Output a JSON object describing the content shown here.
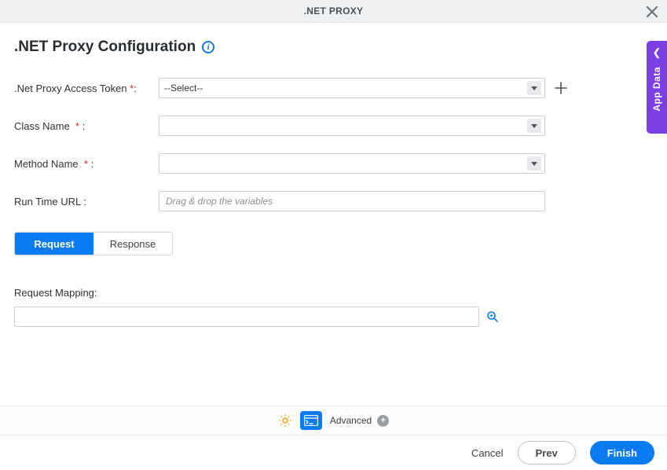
{
  "titlebar": {
    "title": ".NET PROXY"
  },
  "header": {
    "title": ".NET Proxy Configuration"
  },
  "form": {
    "access_token": {
      "label": ".Net Proxy Access Token",
      "required": "*",
      "colon": ":",
      "value": "--Select--"
    },
    "class_name": {
      "label": "Class Name",
      "required": "*",
      "colon": ":",
      "value": ""
    },
    "method_name": {
      "label": "Method Name",
      "required": "*",
      "colon": ":",
      "value": ""
    },
    "runtime_url": {
      "label": "Run Time URL :",
      "placeholder": "Drag & drop the variables"
    }
  },
  "tabs": {
    "request": "Request",
    "response": "Response"
  },
  "section": {
    "request_mapping_label": "Request Mapping:"
  },
  "toolbar": {
    "advanced": "Advanced"
  },
  "footer": {
    "cancel": "Cancel",
    "prev": "Prev",
    "finish": "Finish"
  },
  "drawer": {
    "label": "App Data"
  }
}
